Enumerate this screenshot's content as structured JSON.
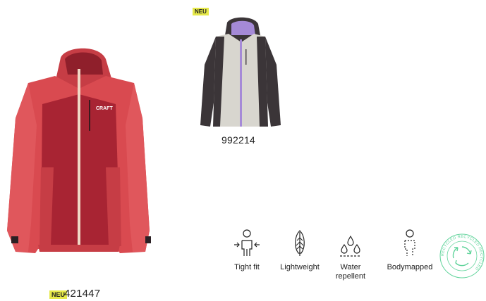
{
  "main_product": {
    "badge": "NEU",
    "code": "421447"
  },
  "variant_product": {
    "badge": "NEU",
    "code": "992214"
  },
  "features": [
    {
      "icon": "tight-fit-icon",
      "label": "Tight fit"
    },
    {
      "icon": "lightweight-icon",
      "label": "Lightweight"
    },
    {
      "icon": "water-repellent-icon",
      "label_line1": "Water",
      "label_line2": "repellent"
    },
    {
      "icon": "bodymapped-icon",
      "label": "Bodymapped"
    }
  ],
  "recycled_seal": {
    "icon": "recycled-seal-icon",
    "text": "RECYCLED RECYCLED RECYCLED",
    "color": "#5fd39a"
  },
  "colors": {
    "badge_bg": "#e6e94a",
    "main_jacket": "#d94a50",
    "main_jacket_panel": "#a82433",
    "variant_body": "#d8d6cf",
    "variant_sleeves": "#3b3538",
    "variant_zip": "#a58ad7"
  }
}
